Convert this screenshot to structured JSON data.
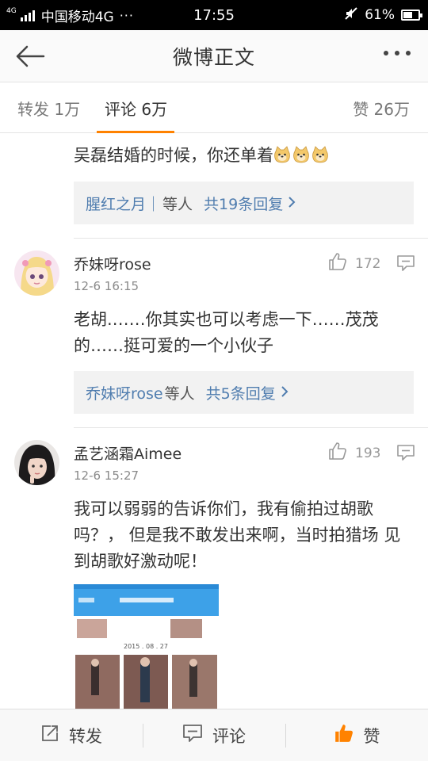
{
  "status_bar": {
    "network_type": "4G",
    "carrier": "中国移动4G",
    "more": "···",
    "time": "17:55",
    "battery": "61%",
    "battery_level": 0.61
  },
  "nav": {
    "title": "微博正文",
    "back_icon": "arrow-left-icon",
    "more_icon": "more-dots-icon"
  },
  "tabs": {
    "repost": "转发 1万",
    "comment": "评论 6万",
    "like": "赞 26万",
    "active": "comment",
    "accent_color": "#ff8200"
  },
  "comments": [
    {
      "text": "吴磊结婚的时候，你还单着",
      "emoji_icon": "doge-emoji-icon",
      "reply": {
        "users": "腥红之月｜",
        "others": "等人",
        "count": "共19条回复"
      }
    },
    {
      "user": "乔妹呀rose",
      "time": "12-6 16:15",
      "likes": "172",
      "text": "老胡.……你其实也可以考虑一下……茂茂的……挺可爱的一个小伙子",
      "reply": {
        "users": "乔妹呀rose",
        "others": "等人",
        "count": "共5条回复"
      }
    },
    {
      "user": "孟艺涵霜Aimee",
      "time": "12-6 15:27",
      "likes": "193",
      "text": "我可以弱弱的告诉你们，我有偷拍过胡歌吗？，  但是我不敢发出来啊，当时拍猎场 见到胡歌好激动呢！",
      "image": {
        "icon": "photo-thumbnail-icon",
        "date": "2015 . 08 . 27"
      }
    }
  ],
  "bottom_bar": {
    "repost": "转发",
    "comment": "评论",
    "like": "赞"
  },
  "colors": {
    "link": "#507daf",
    "accent": "#ff8200"
  }
}
